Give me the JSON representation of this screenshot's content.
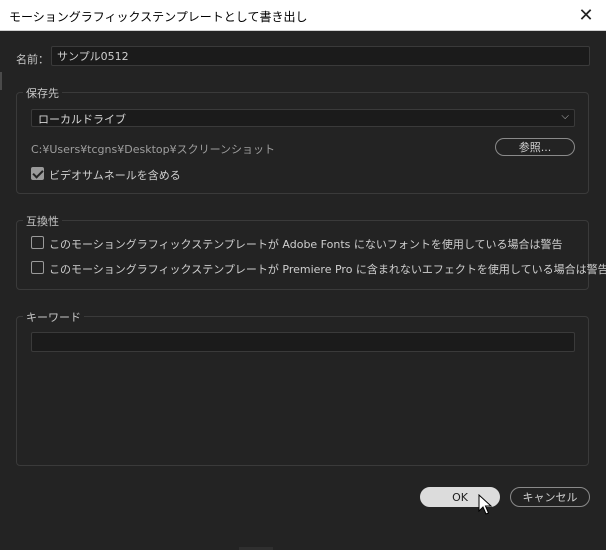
{
  "window": {
    "title": "モーショングラフィックステンプレートとして書き出し",
    "close_glyph": "✕"
  },
  "name_field": {
    "label": "名前：",
    "value": "サンプル0512"
  },
  "destination": {
    "legend": "保存先",
    "selected": "ローカルドライブ",
    "path": "C:¥Users¥tcgns¥Desktop¥スクリーンショット",
    "browse_label": "参照...",
    "include_thumbnail_label": "ビデオサムネールを含める",
    "include_thumbnail_checked": true
  },
  "compatibility": {
    "legend": "互換性",
    "warn_fonts_label": "このモーショングラフィックステンプレートが Adobe Fonts にないフォントを使用している場合は警告",
    "warn_fonts_checked": false,
    "warn_effects_label": "このモーショングラフィックステンプレートが Premiere Pro に含まれないエフェクトを使用している場合は警告",
    "warn_effects_checked": false
  },
  "keywords": {
    "legend": "キーワード",
    "value": ""
  },
  "footer": {
    "ok_label": "OK",
    "cancel_label": "キャンセル"
  },
  "colors": {
    "background": "#232323",
    "titlebar": "#ffffff",
    "ok_button": "#dcdcdc"
  }
}
